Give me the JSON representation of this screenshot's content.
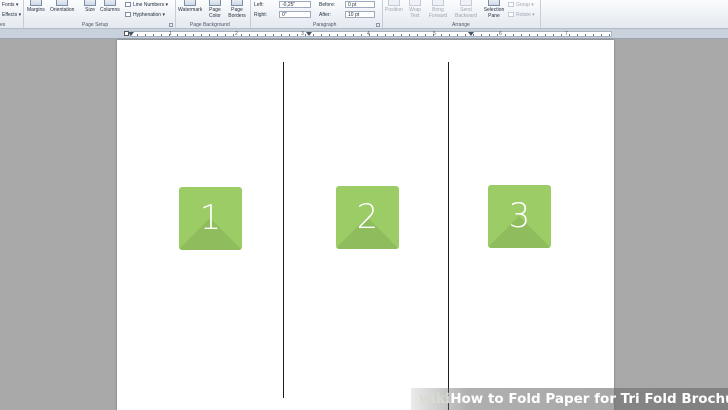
{
  "ribbon": {
    "themes": {
      "fonts": "Fonts",
      "effects": "Effects",
      "group_label": "es"
    },
    "page_setup": {
      "margins": "Margins",
      "orientation": "Orientation",
      "size": "Size",
      "columns": "Columns",
      "line_numbers": "Line Numbers",
      "hyphenation": "Hyphenation",
      "group_label": "Page Setup"
    },
    "page_background": {
      "watermark": "Watermark",
      "page_color": "Page Color",
      "page_borders": "Page Borders",
      "group_label": "Page Background"
    },
    "paragraph": {
      "indent_left_label": "Left:",
      "indent_left_value": "-0,25\"",
      "indent_right_label": "Right:",
      "indent_right_value": "0\"",
      "spacing_before_label": "Before:",
      "spacing_before_value": "0 pt",
      "spacing_after_label": "After:",
      "spacing_after_value": "10 pt",
      "group_label": "Paragraph"
    },
    "arrange": {
      "position": "Position",
      "wrap_text": "Wrap Text",
      "bring_forward": "Bring Forward",
      "send_backward": "Send Backward",
      "selection_pane": "Selection Pane",
      "group": "Group",
      "rotate": "Rotate",
      "group_label": "Arrange"
    }
  },
  "ruler": {
    "numbers": [
      "1",
      "2",
      "3",
      "4",
      "5",
      "6",
      "7"
    ]
  },
  "document": {
    "panels": [
      {
        "number": "1"
      },
      {
        "number": "2"
      },
      {
        "number": "3"
      }
    ],
    "badge_color": "#9ccc65"
  },
  "watermark": {
    "brand_wiki": "wiki",
    "brand_how": "How",
    "title": " to Fold Paper for Tri Fold Brochures"
  }
}
